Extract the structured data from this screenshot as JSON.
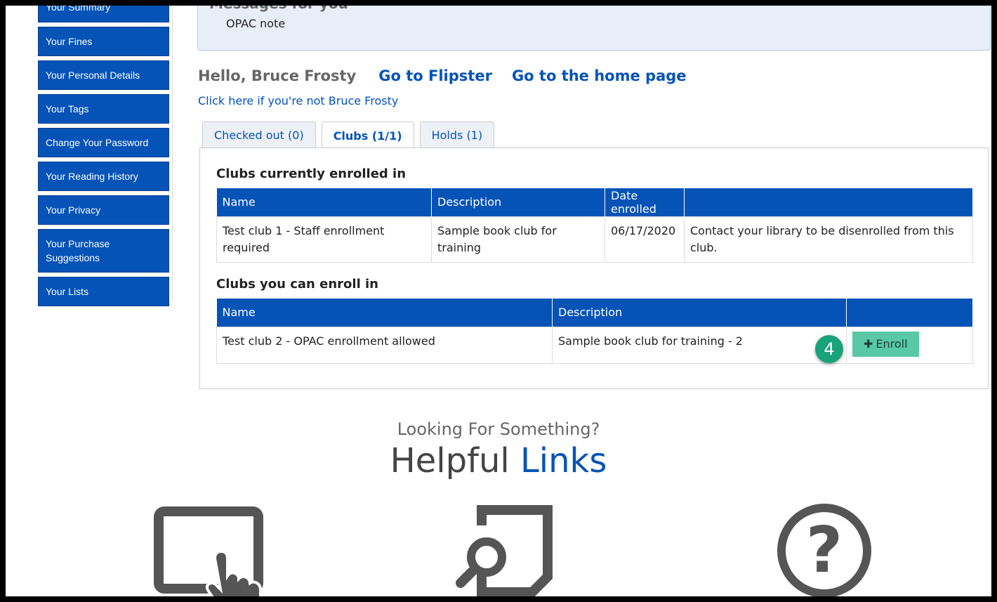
{
  "sidebar": {
    "items": [
      {
        "label": "Your Summary",
        "name": "sidebar-item-summary"
      },
      {
        "label": "Your Fines",
        "name": "sidebar-item-fines"
      },
      {
        "label": "Your Personal Details",
        "name": "sidebar-item-personal-details"
      },
      {
        "label": "Your Tags",
        "name": "sidebar-item-tags"
      },
      {
        "label": "Change Your Password",
        "name": "sidebar-item-change-password"
      },
      {
        "label": "Your Reading History",
        "name": "sidebar-item-reading-history"
      },
      {
        "label": "Your Privacy",
        "name": "sidebar-item-privacy"
      },
      {
        "label": "Your Purchase Suggestions",
        "name": "sidebar-item-purchase-suggestions"
      },
      {
        "label": "Your Lists",
        "name": "sidebar-item-lists"
      }
    ]
  },
  "messages": {
    "title": "Messages for you",
    "note": "OPAC note"
  },
  "greeting": {
    "hello": "Hello, Bruce Frosty",
    "flipster_link": "Go to Flipster",
    "home_link": "Go to the home page",
    "not_me_link": "Click here if you're not Bruce Frosty"
  },
  "tabs": [
    {
      "label": "Checked out (0)",
      "active": false
    },
    {
      "label": "Clubs (1/1)",
      "active": true
    },
    {
      "label": "Holds (1)",
      "active": false
    }
  ],
  "enrolled": {
    "title": "Clubs currently enrolled in",
    "headers": [
      "Name",
      "Description",
      "Date enrolled",
      ""
    ],
    "rows": [
      {
        "name": "Test club 1 - Staff enrollment required",
        "description": "Sample book club for training",
        "date": "06/17/2020",
        "note": "Contact your library to be disenrolled from this club."
      }
    ]
  },
  "available": {
    "title": "Clubs you can enroll in",
    "headers": [
      "Name",
      "Description",
      ""
    ],
    "rows": [
      {
        "name": "Test club 2 - OPAC enrollment allowed",
        "description": "Sample book club for training - 2",
        "button": "Enroll"
      }
    ]
  },
  "step_badge": "4",
  "helpful": {
    "subtitle": "Looking For Something?",
    "title_part1": "Helpful",
    "title_part2": "Links"
  },
  "colors": {
    "primary_blue": "#0553b7",
    "enroll_green": "#59c9a5",
    "badge_green": "#1aa37a"
  }
}
